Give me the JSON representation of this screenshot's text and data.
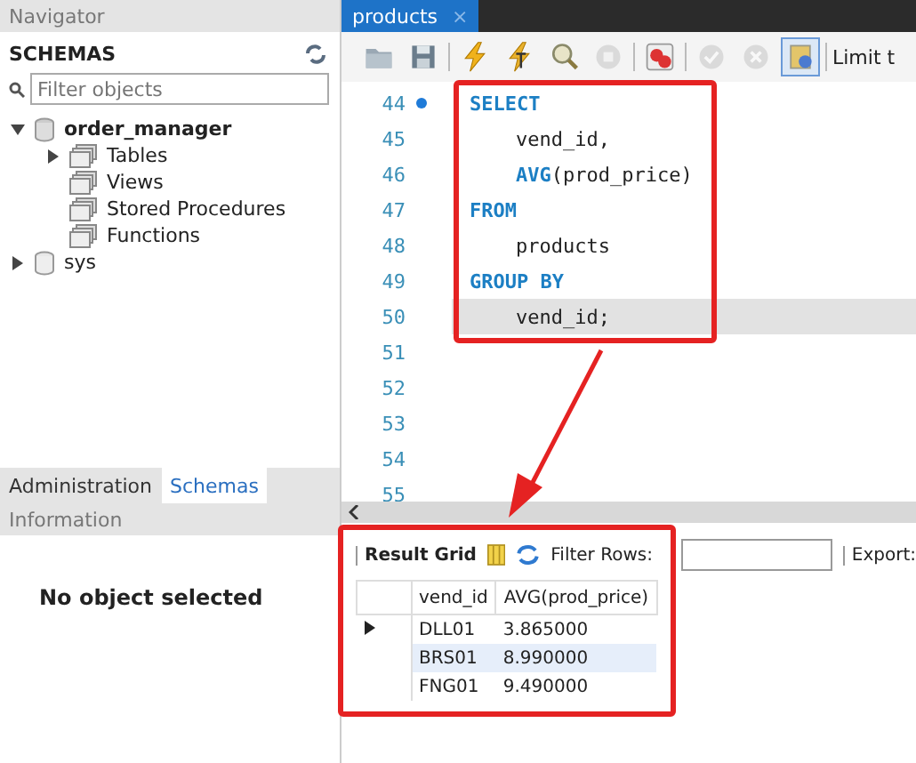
{
  "navigator": {
    "title": "Navigator",
    "schemas_label": "SCHEMAS",
    "filter": {
      "placeholder": "Filter objects"
    },
    "schemas": [
      {
        "label": "order_manager",
        "default": true,
        "expanded": true,
        "children": [
          {
            "label": "Tables",
            "expandable": true
          },
          {
            "label": "Views",
            "expandable": false
          },
          {
            "label": "Stored Procedures",
            "expandable": false
          },
          {
            "label": "Functions",
            "expandable": false
          }
        ]
      },
      {
        "label": "sys",
        "default": false,
        "expanded": false
      }
    ]
  },
  "side_tabs": [
    {
      "label": "Administration",
      "selected": false
    },
    {
      "label": "Schemas",
      "selected": true
    }
  ],
  "information": {
    "title": "Information",
    "message": "No object selected"
  },
  "editor_tabs": [
    {
      "label": "products",
      "selected": true,
      "close": "×"
    }
  ],
  "toolbar": {
    "buttons": [
      {
        "kind": "folder",
        "disabled": false,
        "selected": false
      },
      {
        "kind": "save",
        "disabled": false,
        "selected": false
      },
      {
        "kind": "sep"
      },
      {
        "kind": "bolt",
        "disabled": false,
        "selected": false
      },
      {
        "kind": "bolt-cursor",
        "disabled": false,
        "selected": false
      },
      {
        "kind": "magnifier",
        "disabled": false,
        "selected": false
      },
      {
        "kind": "stop",
        "disabled": true,
        "selected": false
      },
      {
        "kind": "sep"
      },
      {
        "kind": "error",
        "disabled": false,
        "selected": false
      },
      {
        "kind": "sep"
      },
      {
        "kind": "check",
        "disabled": true,
        "selected": false
      },
      {
        "kind": "cancel",
        "disabled": true,
        "selected": false
      },
      {
        "kind": "toggle",
        "disabled": false,
        "selected": true
      }
    ],
    "limit_label": "Limit t"
  },
  "editor": {
    "lines": [
      {
        "number": "44",
        "marker": true,
        "current": false,
        "indent": false,
        "tokens": [
          {
            "text": "SELECT",
            "kind": "keyword"
          }
        ]
      },
      {
        "number": "45",
        "marker": false,
        "current": false,
        "indent": true,
        "tokens": [
          {
            "text": "vend_id,",
            "kind": "plain"
          }
        ]
      },
      {
        "number": "46",
        "marker": false,
        "current": false,
        "indent": true,
        "tokens": [
          {
            "text": "AVG",
            "kind": "keyword"
          },
          {
            "text": "(prod_price)",
            "kind": "plain"
          }
        ]
      },
      {
        "number": "47",
        "marker": false,
        "current": false,
        "indent": false,
        "tokens": [
          {
            "text": "FROM",
            "kind": "keyword"
          }
        ]
      },
      {
        "number": "48",
        "marker": false,
        "current": false,
        "indent": true,
        "tokens": [
          {
            "text": "products",
            "kind": "plain"
          }
        ]
      },
      {
        "number": "49",
        "marker": false,
        "current": false,
        "indent": false,
        "tokens": [
          {
            "text": "GROUP BY",
            "kind": "keyword"
          }
        ]
      },
      {
        "number": "50",
        "marker": false,
        "current": true,
        "indent": true,
        "tokens": [
          {
            "text": "vend_id;",
            "kind": "plain"
          }
        ]
      },
      {
        "number": "51",
        "marker": false,
        "current": false
      },
      {
        "number": "52",
        "marker": false,
        "current": false
      },
      {
        "number": "53",
        "marker": false,
        "current": false
      },
      {
        "number": "54",
        "marker": false,
        "current": false
      },
      {
        "number": "55",
        "marker": false,
        "current": false
      }
    ]
  },
  "results": {
    "title": "Result Grid",
    "filter_label": "Filter Rows:",
    "export_label": "Export:",
    "columns": [
      "vend_id",
      "AVG(prod_price)"
    ],
    "rows": [
      {
        "cells": [
          "DLL01",
          "3.865000"
        ],
        "pointer": true,
        "selected": false
      },
      {
        "cells": [
          "BRS01",
          "8.990000"
        ],
        "pointer": false,
        "selected": true
      },
      {
        "cells": [
          "FNG01",
          "9.490000"
        ],
        "pointer": false,
        "selected": false
      }
    ]
  }
}
